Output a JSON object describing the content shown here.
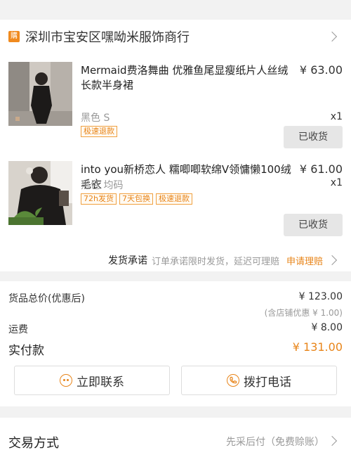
{
  "shop": {
    "badge": "購",
    "name": "深圳市宝安区嘿呦米服饰商行"
  },
  "items": [
    {
      "title": "Mermaid费洛舞曲 优雅鱼尾显瘦纸片人丝绒长款半身裙",
      "price": "¥ 63.00",
      "qty": "x1",
      "spec": "黑色 S",
      "tags": [
        "极速退款"
      ],
      "status": "已收货"
    },
    {
      "title": "into you新桥恋人 糯唧唧软绵V领慵懒100绒毛衣",
      "price": "¥ 61.00",
      "qty": "x1",
      "spec": "黑色 均码",
      "tags": [
        "72h发货",
        "7天包换",
        "极速退款"
      ],
      "status": "已收货"
    }
  ],
  "promise": {
    "title": "发货承诺",
    "text": "订单承诺限时发货，延迟可理赔",
    "link": "申请理赔"
  },
  "totals": {
    "goods_label": "货品总价(优惠后)",
    "goods_value": "¥ 123.00",
    "discount_note": "(含店铺优惠 ¥ 1.00)",
    "shipping_label": "运费",
    "shipping_value": "¥ 8.00",
    "paid_label": "实付款",
    "paid_value": "¥ 131.00"
  },
  "actions": {
    "contact": "立即联系",
    "call": "拨打电话"
  },
  "trade": {
    "label": "交易方式",
    "value": "先采后付（免费赊账）"
  },
  "colors": {
    "accent": "#e8851a",
    "background": "#f2f2f2"
  }
}
